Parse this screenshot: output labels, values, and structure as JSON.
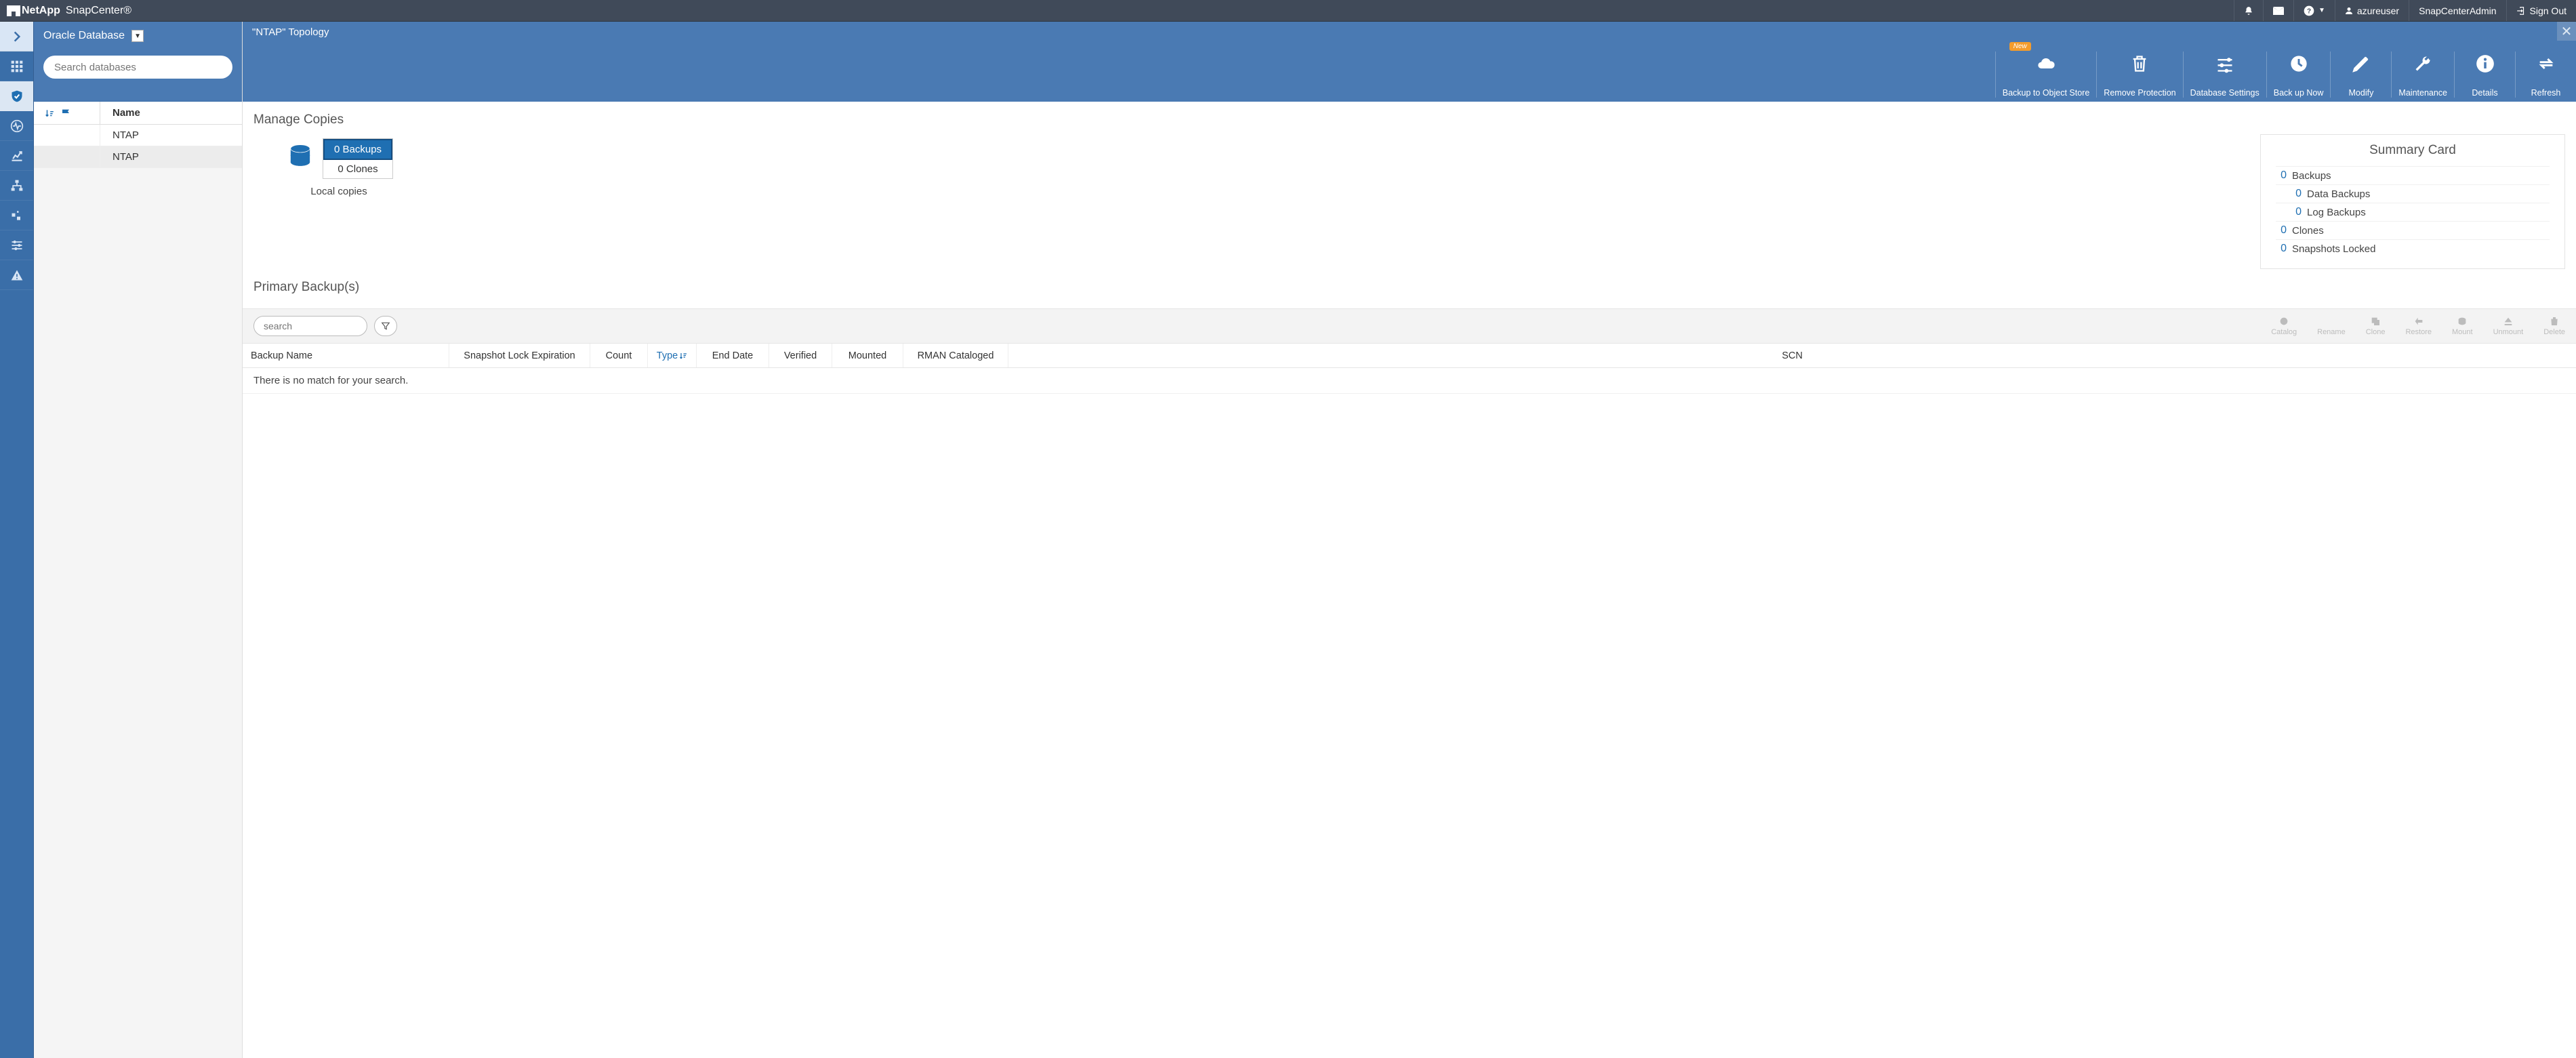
{
  "header": {
    "brand": "NetApp",
    "product": "SnapCenter®",
    "user": "azureuser",
    "role": "SnapCenterAdmin",
    "signout": "Sign Out"
  },
  "sidebar": {
    "resource_type": "Oracle Database",
    "search_placeholder": "Search databases",
    "name_header": "Name",
    "rows": [
      "NTAP",
      "NTAP"
    ]
  },
  "main": {
    "title": "\"NTAP\" Topology",
    "actions": [
      {
        "label": "Backup to Object Store",
        "icon": "cloud",
        "badge": "New"
      },
      {
        "label": "Remove Protection",
        "icon": "trash"
      },
      {
        "label": "Database Settings",
        "icon": "sliders"
      },
      {
        "label": "Back up Now",
        "icon": "clock"
      },
      {
        "label": "Modify",
        "icon": "pencil"
      },
      {
        "label": "Maintenance",
        "icon": "wrench"
      },
      {
        "label": "Details",
        "icon": "info"
      },
      {
        "label": "Refresh",
        "icon": "refresh"
      }
    ],
    "manage_copies_title": "Manage Copies",
    "local_copies": {
      "backups": "0 Backups",
      "clones": "0 Clones",
      "caption": "Local copies"
    },
    "summary": {
      "title": "Summary Card",
      "lines": [
        {
          "num": "0",
          "label": "Backups",
          "indent": false
        },
        {
          "num": "0",
          "label": "Data Backups",
          "indent": true
        },
        {
          "num": "0",
          "label": "Log Backups",
          "indent": true
        },
        {
          "num": "0",
          "label": "Clones",
          "indent": false
        },
        {
          "num": "0",
          "label": "Snapshots Locked",
          "indent": false
        }
      ]
    },
    "primary_backups_title": "Primary Backup(s)",
    "pb_search_placeholder": "search",
    "pb_actions": [
      "Catalog",
      "Rename",
      "Clone",
      "Restore",
      "Mount",
      "Unmount",
      "Delete"
    ],
    "pb_columns": [
      "Backup Name",
      "Snapshot Lock Expiration",
      "Count",
      "Type",
      "End Date",
      "Verified",
      "Mounted",
      "RMAN Cataloged",
      "SCN"
    ],
    "pb_sort_col": "Type",
    "pb_empty": "There is no match for your search."
  }
}
